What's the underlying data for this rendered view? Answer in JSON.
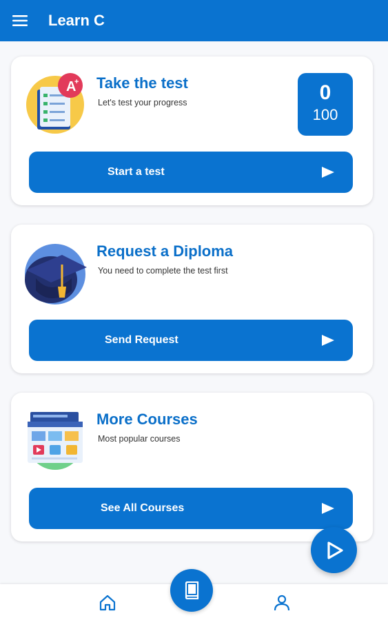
{
  "app": {
    "title": "Learn C",
    "accent_color": "#0a73d0",
    "title_color": "#0a6fc9"
  },
  "header": {
    "menu_icon": "hamburger-icon"
  },
  "cards": {
    "test": {
      "title": "Take the test",
      "subtitle": "Let's test your progress",
      "score": "0",
      "score_max": "100",
      "button_label": "Start a test",
      "illustration": "test-sheet-grade-icon"
    },
    "diploma": {
      "title": "Request a Diploma",
      "subtitle": "You need to complete the test first",
      "button_label": "Send Request",
      "illustration": "graduation-cap-icon"
    },
    "courses": {
      "title": "More Courses",
      "subtitle": "Most popular courses",
      "button_label": "See All Courses",
      "illustration": "course-browser-icon"
    }
  },
  "fab": {
    "icon": "play-icon"
  },
  "bottom_nav": {
    "items": [
      {
        "name": "home",
        "icon": "home-icon"
      },
      {
        "name": "courses",
        "icon": "book-icon",
        "active": true
      },
      {
        "name": "profile",
        "icon": "user-icon"
      }
    ]
  }
}
